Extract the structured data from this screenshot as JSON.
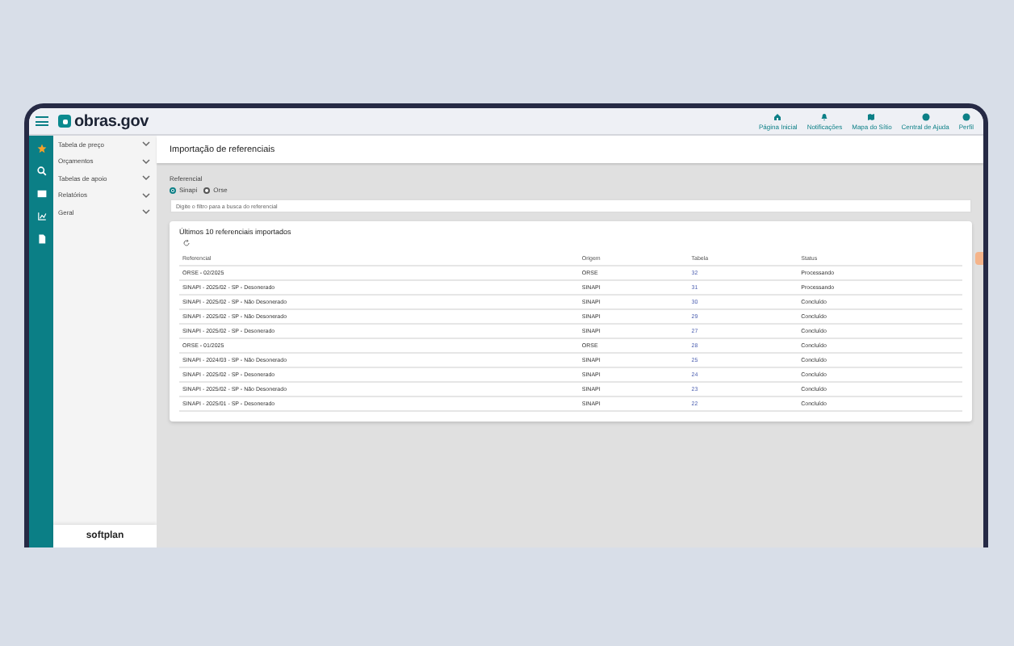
{
  "app": {
    "logo": "obras.gov"
  },
  "top_nav": [
    {
      "label": "Página Inicial"
    },
    {
      "label": "Notificações"
    },
    {
      "label": "Mapa do Sítio"
    },
    {
      "label": "Central de Ajuda"
    },
    {
      "label": "Perfil"
    }
  ],
  "rail": [
    {
      "selected": true
    },
    {
      "selected": false
    },
    {
      "selected": false
    },
    {
      "selected": false
    },
    {
      "selected": false
    }
  ],
  "sidebar": {
    "items": [
      {
        "label": "Tabela de preço",
        "expanded": false
      },
      {
        "label": "Orçamentos",
        "expanded": false
      },
      {
        "label": "Tabelas de apoio",
        "expanded": false
      },
      {
        "label": "Relatórios",
        "expanded": false
      },
      {
        "label": "Geral",
        "expanded": false
      }
    ],
    "footer": "softplan"
  },
  "page": {
    "title": "Importação de referenciais",
    "filter_label": "Referencial",
    "options": [
      {
        "label": "Sinapi",
        "selected": true
      },
      {
        "label": "Orse",
        "selected": false
      }
    ],
    "search": {
      "placeholder": "Digite o filtro para a busca do referencial"
    },
    "card": {
      "title": "Últimos 10 referenciais importados",
      "columns": [
        "Referencial",
        "Origem",
        "Tabela",
        "Status"
      ],
      "rows": [
        [
          "ORSE - 02/2025",
          "ORSE",
          "32",
          "Processando"
        ],
        [
          "SINAPI - 2025/02 - SP - Desonerado",
          "SINAPI",
          "31",
          "Processando"
        ],
        [
          "SINAPI - 2025/02 - SP - Não Desonerado",
          "SINAPI",
          "30",
          "Concluído"
        ],
        [
          "SINAPI - 2025/02 - SP - Não Desonerado",
          "SINAPI",
          "29",
          "Concluído"
        ],
        [
          "SINAPI - 2025/02 - SP - Desonerado",
          "SINAPI",
          "27",
          "Concluído"
        ],
        [
          "ORSE - 01/2025",
          "ORSE",
          "28",
          "Concluído"
        ],
        [
          "SINAPI - 2024/03 - SP - Não Desonerado",
          "SINAPI",
          "25",
          "Concluído"
        ],
        [
          "SINAPI - 2025/02 - SP - Desonerado",
          "SINAPI",
          "24",
          "Concluído"
        ],
        [
          "SINAPI - 2025/02 - SP - Não Desonerado",
          "SINAPI",
          "23",
          "Concluído"
        ],
        [
          "SINAPI - 2025/01 - SP - Desonerado",
          "SINAPI",
          "22",
          "Concluído"
        ]
      ]
    }
  }
}
